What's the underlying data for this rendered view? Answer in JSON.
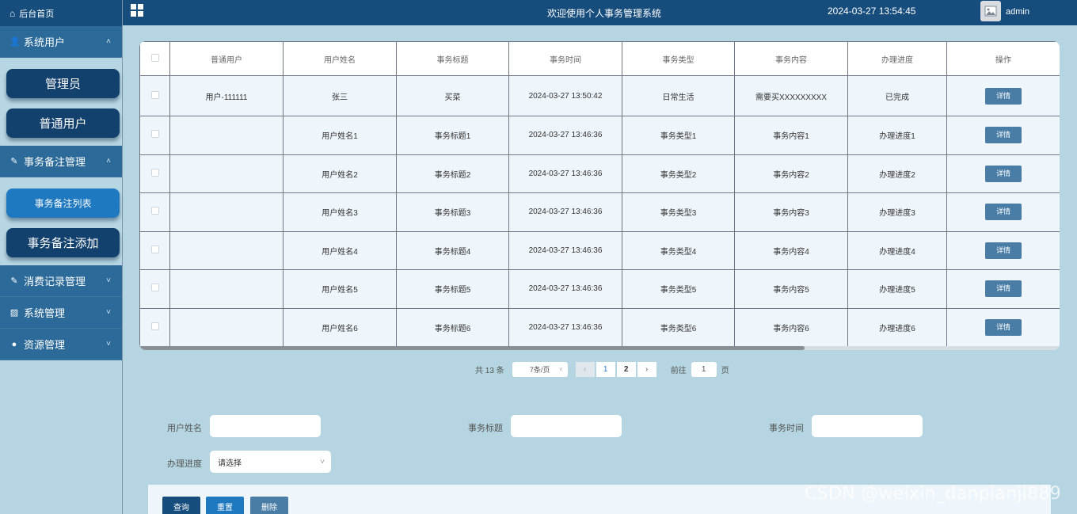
{
  "sidebar": {
    "home_label": "后台首页",
    "groups": [
      {
        "label": "系统用户",
        "chevron": "˄",
        "items": [
          "管理员",
          "普通用户"
        ]
      },
      {
        "label": "事务备注管理",
        "chevron": "˄",
        "items": [
          "事务备注列表",
          "事务备注添加"
        ]
      },
      {
        "label": "消费记录管理",
        "chevron": "˅"
      },
      {
        "label": "系统管理",
        "chevron": "˅"
      },
      {
        "label": "资源管理",
        "chevron": "˅"
      }
    ]
  },
  "header": {
    "title": "欢迎使用个人事务管理系统",
    "datetime": "2024-03-27 13:54:45",
    "username": "admin"
  },
  "table": {
    "columns": [
      "普通用户",
      "用户姓名",
      "事务标题",
      "事务时间",
      "事务类型",
      "事务内容",
      "办理进度",
      "操作"
    ],
    "action_label": "详情",
    "rows": [
      [
        "用户-111111",
        "张三",
        "买菜",
        "2024-03-27 13:50:42",
        "日常生活",
        "需要买XXXXXXXXX",
        "已完成"
      ],
      [
        "",
        "用户姓名1",
        "事务标题1",
        "2024-03-27 13:46:36",
        "事务类型1",
        "事务内容1",
        "办理进度1"
      ],
      [
        "",
        "用户姓名2",
        "事务标题2",
        "2024-03-27 13:46:36",
        "事务类型2",
        "事务内容2",
        "办理进度2"
      ],
      [
        "",
        "用户姓名3",
        "事务标题3",
        "2024-03-27 13:46:36",
        "事务类型3",
        "事务内容3",
        "办理进度3"
      ],
      [
        "",
        "用户姓名4",
        "事务标题4",
        "2024-03-27 13:46:36",
        "事务类型4",
        "事务内容4",
        "办理进度4"
      ],
      [
        "",
        "用户姓名5",
        "事务标题5",
        "2024-03-27 13:46:36",
        "事务类型5",
        "事务内容5",
        "办理进度5"
      ],
      [
        "",
        "用户姓名6",
        "事务标题6",
        "2024-03-27 13:46:36",
        "事务类型6",
        "事务内容6",
        "办理进度6"
      ]
    ]
  },
  "pager": {
    "total": "共 13 条",
    "page_size": "7条/页",
    "prev": "‹",
    "next": "›",
    "pages": [
      "1",
      "2"
    ],
    "goto_label": "前往",
    "goto_value": "1",
    "goto_suffix": "页"
  },
  "form": {
    "username_label": "用户姓名",
    "title_label": "事务标题",
    "time_label": "事务时间",
    "progress_label": "办理进度",
    "progress_value": "请选择"
  },
  "actions": {
    "query": "查询",
    "reset": "重置",
    "delete": "删除"
  },
  "watermark": "CSDN @weixin_danpianji889",
  "colors": {
    "header_bg": "#164d7d",
    "menu_head_bg": "#2b6a99",
    "page_bg": "#b4d5e1",
    "detail_btn": "#4a7da6",
    "query_btn": "#164d7d",
    "reset_btn": "#1e79c1",
    "delete_btn": "#4a7da6"
  }
}
